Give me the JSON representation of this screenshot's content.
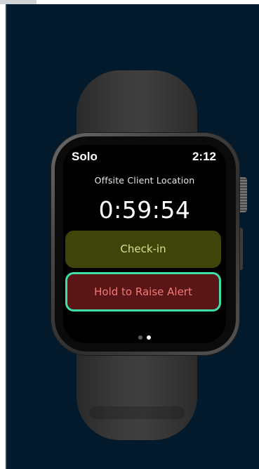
{
  "watch": {
    "app_name": "Solo",
    "time": "2:12",
    "location": "Offsite Client Location",
    "timer": "0:59:54",
    "buttons": {
      "checkin_label": "Check-in",
      "alert_label": "Hold to Raise Alert"
    },
    "page_indicator": {
      "total": 2,
      "active_index": 1
    }
  },
  "colors": {
    "background": "#021a2c",
    "checkin_bg": "#3f440a",
    "checkin_text": "#d8e08a",
    "alert_bg": "#5a1616",
    "alert_text": "#f07a78",
    "alert_focus_border": "#3fe0a8"
  }
}
